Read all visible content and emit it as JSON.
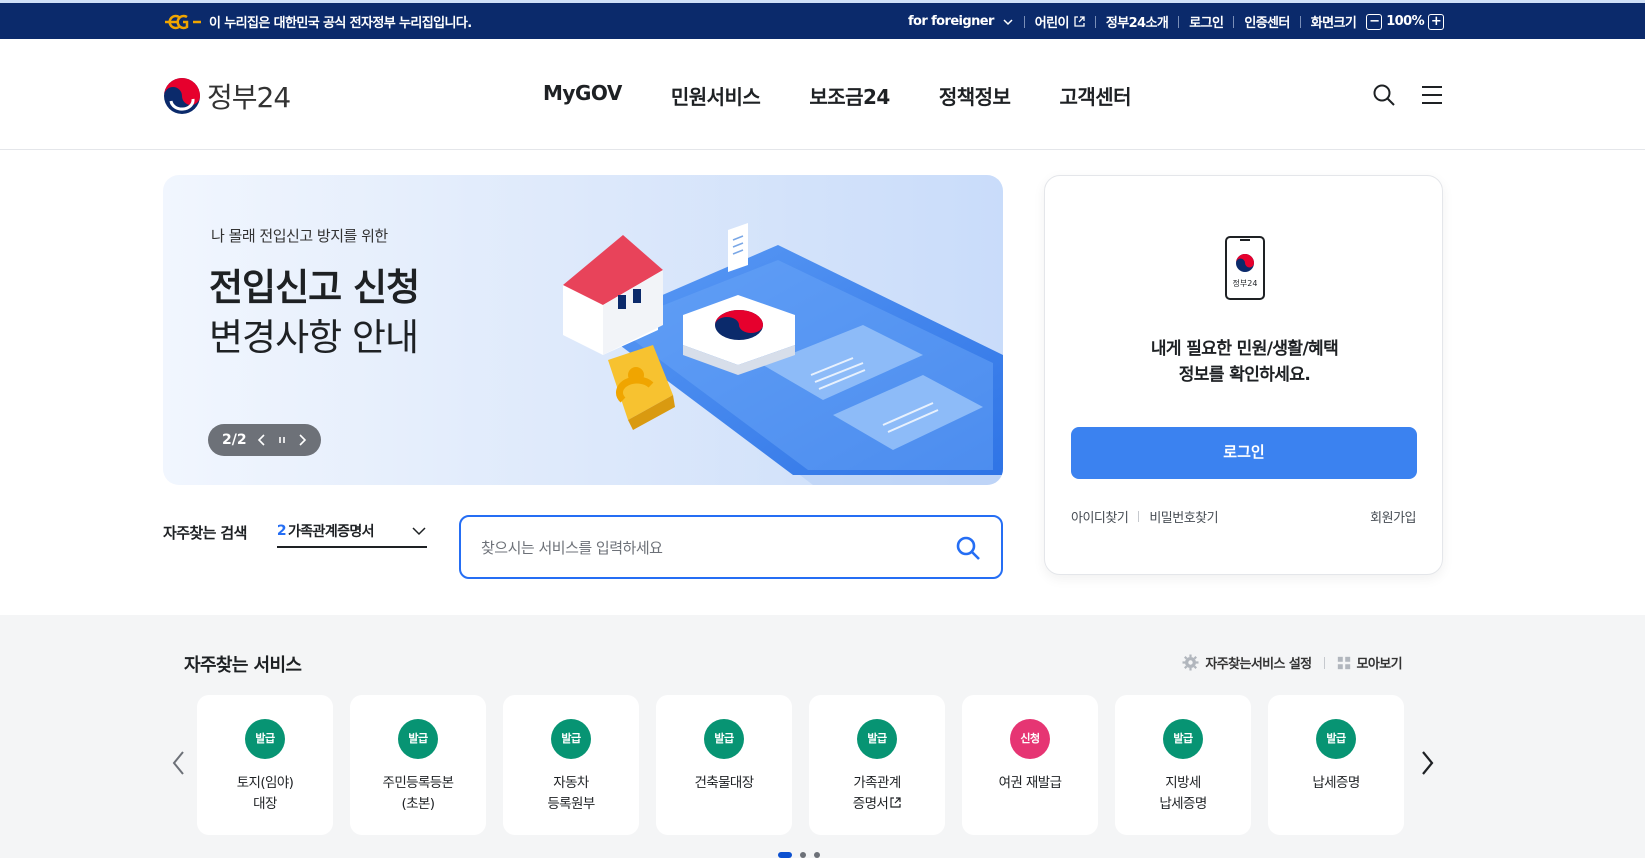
{
  "topbar": {
    "notice": "이 누리집은 대한민국 공식 전자정부 누리집입니다.",
    "foreigner": "for foreigner",
    "kids": "어린이",
    "about": "정부24소개",
    "login": "로그인",
    "cert": "인증센터",
    "zoom_label": "화면크기",
    "zoom_minus": "−",
    "zoom_value": "100%",
    "zoom_plus": "+"
  },
  "header": {
    "logo": "정부24",
    "nav": [
      "MyGOV",
      "민원서비스",
      "보조금24",
      "정책정보",
      "고객센터"
    ]
  },
  "banner": {
    "sub": "나 몰래 전입신고 방지를 위한",
    "title_line1": "전입신고 신청",
    "title_line2": "변경사항 안내",
    "page": "2/2"
  },
  "quick_search": {
    "label": "자주찾는 검색",
    "rank": "2",
    "keyword": "가족관계증명서",
    "placeholder": "찾으시는 서비스를 입력하세요"
  },
  "login_card": {
    "phone_text": "정부24",
    "msg_line1": "내게 필요한 민원/생활/혜택",
    "msg_line2": "정보를 확인하세요.",
    "button": "로그인",
    "find_id": "아이디찾기",
    "find_pw": "비밀번호찾기",
    "join": "회원가입"
  },
  "services": {
    "title": "자주찾는 서비스",
    "settings": "자주찾는서비스 설정",
    "view_all": "모아보기",
    "items": [
      {
        "badge": "발급",
        "label": "토지(임야)\n대장",
        "color": "#079473"
      },
      {
        "badge": "발급",
        "label": "주민등록등본\n(초본)",
        "color": "#079473"
      },
      {
        "badge": "발급",
        "label": "자동차\n등록원부",
        "color": "#079473"
      },
      {
        "badge": "발급",
        "label": "건축물대장",
        "color": "#079473"
      },
      {
        "badge": "발급",
        "label": "가족관계\n증명서",
        "color": "#079473"
      },
      {
        "badge": "신청",
        "label": "여권 재발급",
        "color": "#e63573"
      },
      {
        "badge": "발급",
        "label": "지방세\n납세증명",
        "color": "#079473"
      },
      {
        "badge": "발급",
        "label": "납세증명",
        "color": "#079473"
      }
    ]
  }
}
